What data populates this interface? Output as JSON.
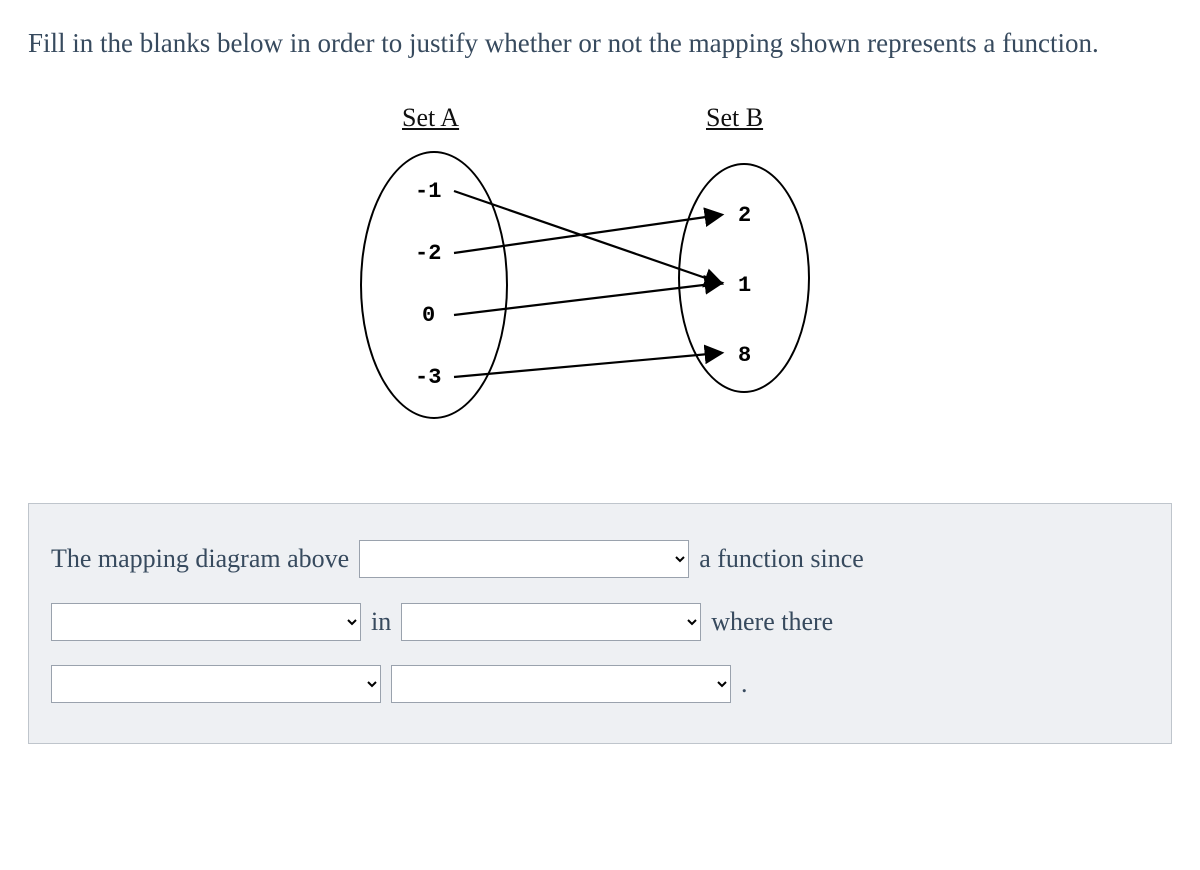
{
  "instructions": "Fill in the blanks below in order to justify whether or not the mapping shown represents a function.",
  "setA": {
    "label": "Set A",
    "values": [
      "-1",
      "-2",
      "0",
      "-3"
    ]
  },
  "setB": {
    "label": "Set B",
    "values": [
      "2",
      "1",
      "8"
    ]
  },
  "sentence": {
    "part1": "The mapping diagram above",
    "part2": "a function since",
    "part3": "in",
    "part4": "where there",
    "part5": "."
  }
}
